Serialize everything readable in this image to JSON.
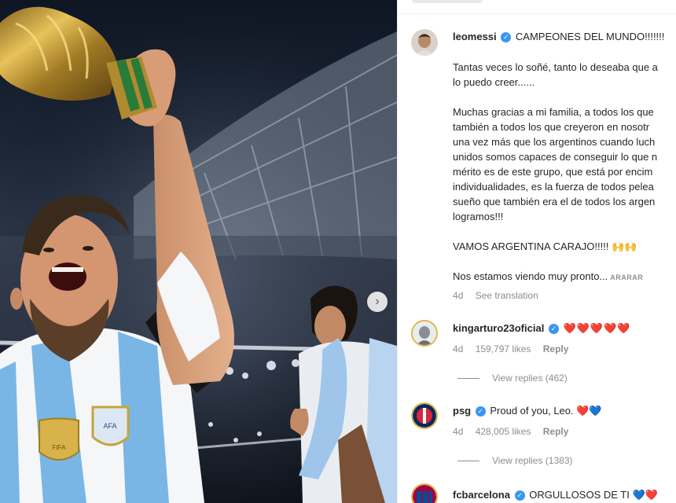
{
  "post": {
    "username": "leomessi",
    "caption_title": "CAMPEONES DEL MUNDO!!!!!!!",
    "caption_lines": [
      "Tantas veces lo soñé, tanto lo deseaba que a",
      "lo puedo creer......",
      "",
      "Muchas gracias a mi familia, a todos los que",
      "también a todos los que creyeron en nosotr",
      "una vez más que los argentinos cuando luch",
      "unidos somos capaces de conseguir lo que n",
      "mérito es de este grupo, que está por encim",
      "individualidades, es la fuerza de todos pelea",
      "sueño que también era el de todos los argen",
      "logramos!!!",
      "",
      "VAMOS ARGENTINA CARAJO!!!!!",
      "",
      "Nos estamos viendo muy pronto..."
    ],
    "caption_emoji": "🙌🙌",
    "more_label": "ARARAR",
    "age": "4d",
    "see_translation": "See translation"
  },
  "comments": [
    {
      "username": "kingarturo23oficial",
      "text": "❤️❤️❤️❤️❤️",
      "age": "4d",
      "likes": "159,797 likes",
      "reply_label": "Reply",
      "view_replies": "View replies (462)"
    },
    {
      "username": "psg",
      "text": "Proud of you, Leo.",
      "hearts": "❤️💙",
      "age": "4d",
      "likes": "428,005 likes",
      "reply_label": "Reply",
      "view_replies": "View replies (1383)"
    },
    {
      "username": "fcbarcelona",
      "text": "ORGULLOSOS DE TI",
      "hearts": "💙❤️"
    }
  ],
  "icons": {
    "verified": "verified-badge-icon",
    "next": "chevron-right-icon"
  },
  "colors": {
    "verified": "#3897f0",
    "meta_text": "#8e8e8e",
    "heart_red": "#ed4956",
    "heart_blue": "#3a6fd8"
  }
}
